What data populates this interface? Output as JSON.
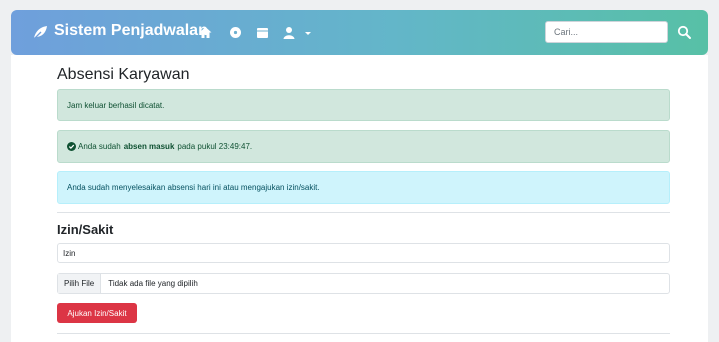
{
  "navbar": {
    "brand": "Sistem Penjadwalan",
    "brand_icon": "leaf-icon",
    "icons": [
      "home-icon",
      "dashboard-icon",
      "calendar-icon",
      "user-icon"
    ],
    "search": {
      "placeholder": "Cari...",
      "value": ""
    },
    "search_icon": "search-icon"
  },
  "main": {
    "title": "Absensi Karyawan",
    "alerts": [
      {
        "type": "success",
        "text": "Jam keluar berhasil dicatat."
      },
      {
        "type": "success",
        "prefix": "Anda sudah",
        "bold": "absen masuk",
        "suffix": "pada pukul 23:49:47."
      },
      {
        "type": "info",
        "text": "Anda sudah menyelesaikan absensi hari ini atau mengajukan izin/sakit."
      }
    ],
    "leave_section": {
      "title": "Izin/Sakit",
      "select_value": "Izin",
      "file_button": "Pilih File",
      "file_status": "Tidak ada file yang dipilih",
      "submit_label": "Ajukan Izin/Sakit"
    }
  },
  "colors": {
    "success_bg": "#d1e7dd",
    "info_bg": "#cff4fc",
    "danger": "#dc3545"
  }
}
